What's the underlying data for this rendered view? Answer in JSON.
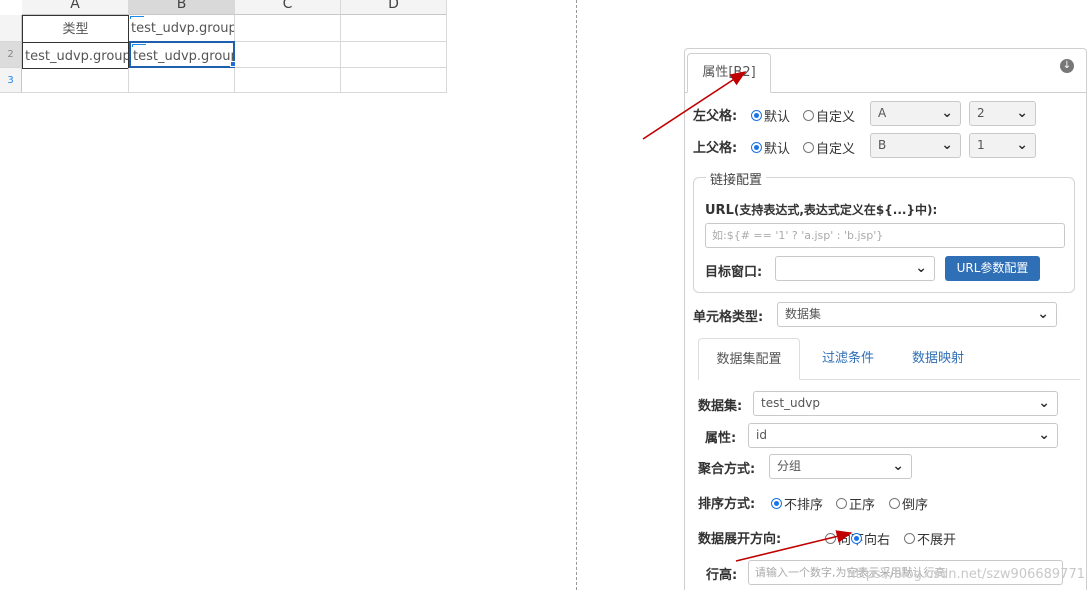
{
  "sheet": {
    "columns": [
      "A",
      "B",
      "C",
      "D"
    ],
    "rows": [
      "2",
      "3"
    ],
    "cells": {
      "a1": "类型",
      "b1": "test_udvp.group(c",
      "a2": "test_udvp.group(",
      "b2": "test_udvp.group(i"
    }
  },
  "panel": {
    "tab": "属性[B2]",
    "left_parent": {
      "label": "左父格:",
      "opt_default": "默认",
      "opt_custom": "自定义",
      "col": "A",
      "row": "2"
    },
    "top_parent": {
      "label": "上父格:",
      "opt_default": "默认",
      "opt_custom": "自定义",
      "col": "B",
      "row": "1"
    },
    "link": {
      "legend": "链接配置",
      "url_label": "URL",
      "url_hint": "(支持表达式,表达式定义在${...}中):",
      "url_placeholder": "如:${# == '1' ? 'a.jsp' : 'b.jsp'}",
      "target_label": "目标窗口:",
      "target_value": "",
      "param_button": "URL参数配置"
    },
    "cell_type": {
      "label": "单元格类型:",
      "value": "数据集"
    },
    "subtabs": [
      "数据集配置",
      "过滤条件",
      "数据映射"
    ],
    "dataset": {
      "label": "数据集:",
      "value": "test_udvp"
    },
    "attr": {
      "label": "属性:",
      "value": "id"
    },
    "agg": {
      "label": "聚合方式:",
      "value": "分组"
    },
    "sort": {
      "label": "排序方式:",
      "options": [
        "不排序",
        "正序",
        "倒序"
      ],
      "selected": "不排序"
    },
    "expand": {
      "label": "数据展开方向:",
      "options": [
        "向下",
        "向右",
        "不展开"
      ],
      "selected": "向右"
    },
    "row_height": {
      "label": "行高:",
      "placeholder": "请输入一个数字,为空表示采用默认行高"
    }
  },
  "watermark": "https://blog.csdn.net/szw906689771",
  "colors": {
    "accent": "#1a73e8",
    "button": "#2f6fb5",
    "arrow": "#c00000"
  }
}
